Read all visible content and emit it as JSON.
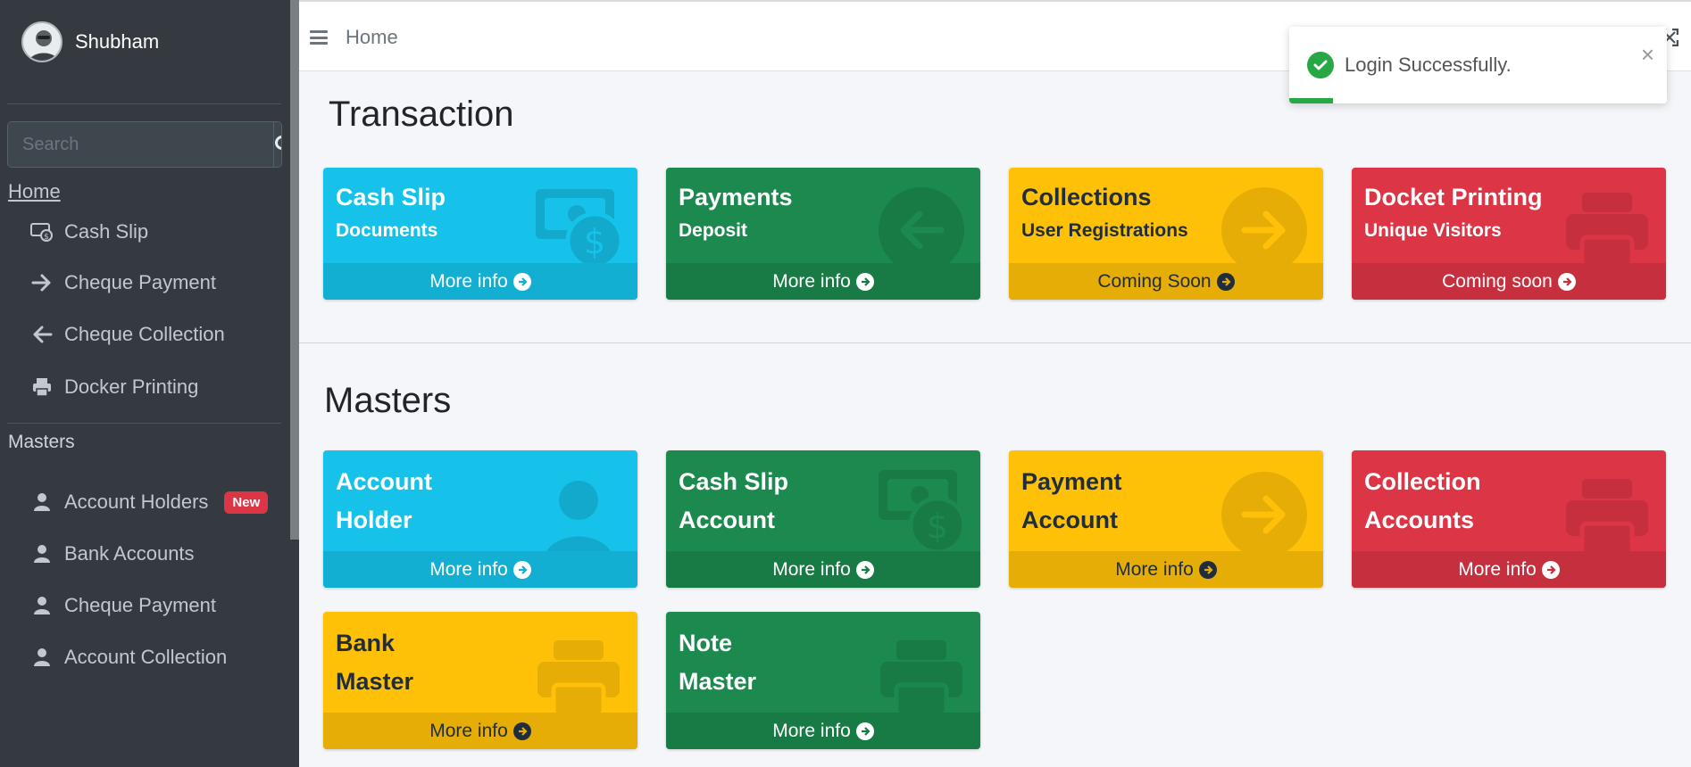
{
  "sidebar": {
    "user_name": "Shubham",
    "search_placeholder": "Search",
    "home_link": "Home",
    "transaction_items": [
      {
        "label": "Cash Slip",
        "icon": "money-icon"
      },
      {
        "label": "Cheque Payment",
        "icon": "arrow-right-icon"
      },
      {
        "label": "Cheque Collection",
        "icon": "arrow-left-icon"
      },
      {
        "label": "Docker Printing",
        "icon": "print-icon"
      }
    ],
    "masters_header": "Masters",
    "master_items": [
      {
        "label": "Account Holders",
        "icon": "user-icon",
        "badge": "New"
      },
      {
        "label": "Bank Accounts",
        "icon": "user-icon"
      },
      {
        "label": "Cheque Payment",
        "icon": "user-icon"
      },
      {
        "label": "Account Collection",
        "icon": "user-icon"
      }
    ]
  },
  "navbar": {
    "breadcrumb": "Home"
  },
  "toast": {
    "message": "Login Successfully.",
    "close": "×"
  },
  "transaction": {
    "title": "Transaction",
    "cards": [
      {
        "title": "Cash Slip",
        "subtitle": "Documents",
        "footer": "More info",
        "color": "info",
        "icon": "money-icon"
      },
      {
        "title": "Payments",
        "subtitle": "Deposit",
        "footer": "More info",
        "color": "success",
        "icon": "arrow-left-circle-icon"
      },
      {
        "title": "Collections",
        "subtitle": "User Registrations",
        "footer": "Coming Soon",
        "color": "warning",
        "icon": "arrow-right-circle-icon"
      },
      {
        "title": "Docket Printing",
        "subtitle": "Unique Visitors",
        "footer": "Coming soon",
        "color": "danger",
        "icon": "print-icon"
      }
    ]
  },
  "masters": {
    "title": "Masters",
    "cards": [
      {
        "line1": "Account",
        "line2": "Holder",
        "footer": "More info",
        "color": "info",
        "icon": "user-icon"
      },
      {
        "line1": "Cash Slip",
        "line2": "Account",
        "footer": "More info",
        "color": "success",
        "icon": "money-icon"
      },
      {
        "line1": "Payment",
        "line2": "Account",
        "footer": "More info",
        "color": "warning",
        "icon": "arrow-right-circle-icon"
      },
      {
        "line1": "Collection",
        "line2": "Accounts",
        "footer": "More info",
        "color": "danger",
        "icon": "print-icon"
      },
      {
        "line1": "Bank",
        "line2": "Master",
        "footer": "More info",
        "color": "warning",
        "icon": "print-icon"
      },
      {
        "line1": "Note",
        "line2": "Master",
        "footer": "More info",
        "color": "success",
        "icon": "print-icon"
      }
    ]
  },
  "colors": {
    "sidebar_bg": "#343a40",
    "info": "#17c2ea",
    "success": "#1c8a4f",
    "warning": "#ffc107",
    "danger": "#dc3545"
  }
}
